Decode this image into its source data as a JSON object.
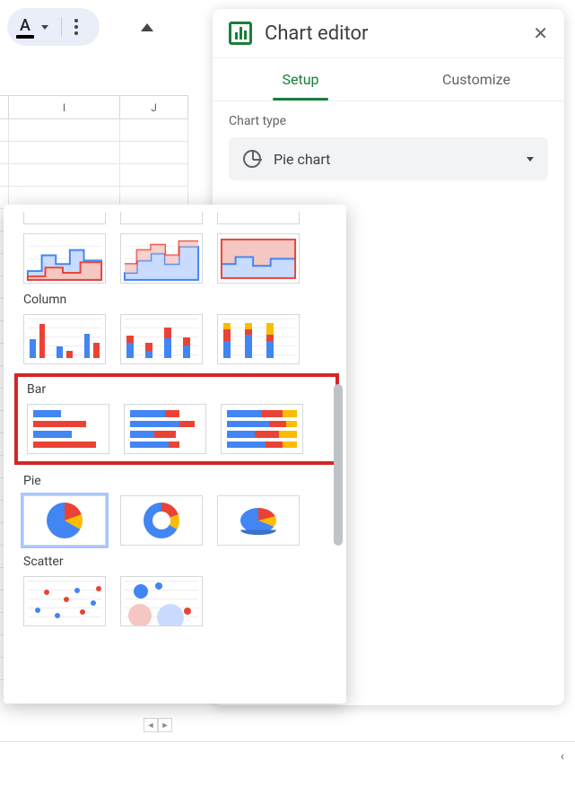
{
  "toolbar": {
    "text_color_letter": "A"
  },
  "sheet": {
    "columns": [
      "I",
      "J"
    ]
  },
  "panel": {
    "title": "Chart editor",
    "tabs": {
      "setup": "Setup",
      "customize": "Customize"
    },
    "chart_type_label": "Chart type",
    "selected_type": "Pie chart"
  },
  "dropdown": {
    "sections": {
      "column": "Column",
      "bar": "Bar",
      "pie": "Pie",
      "scatter": "Scatter"
    }
  }
}
